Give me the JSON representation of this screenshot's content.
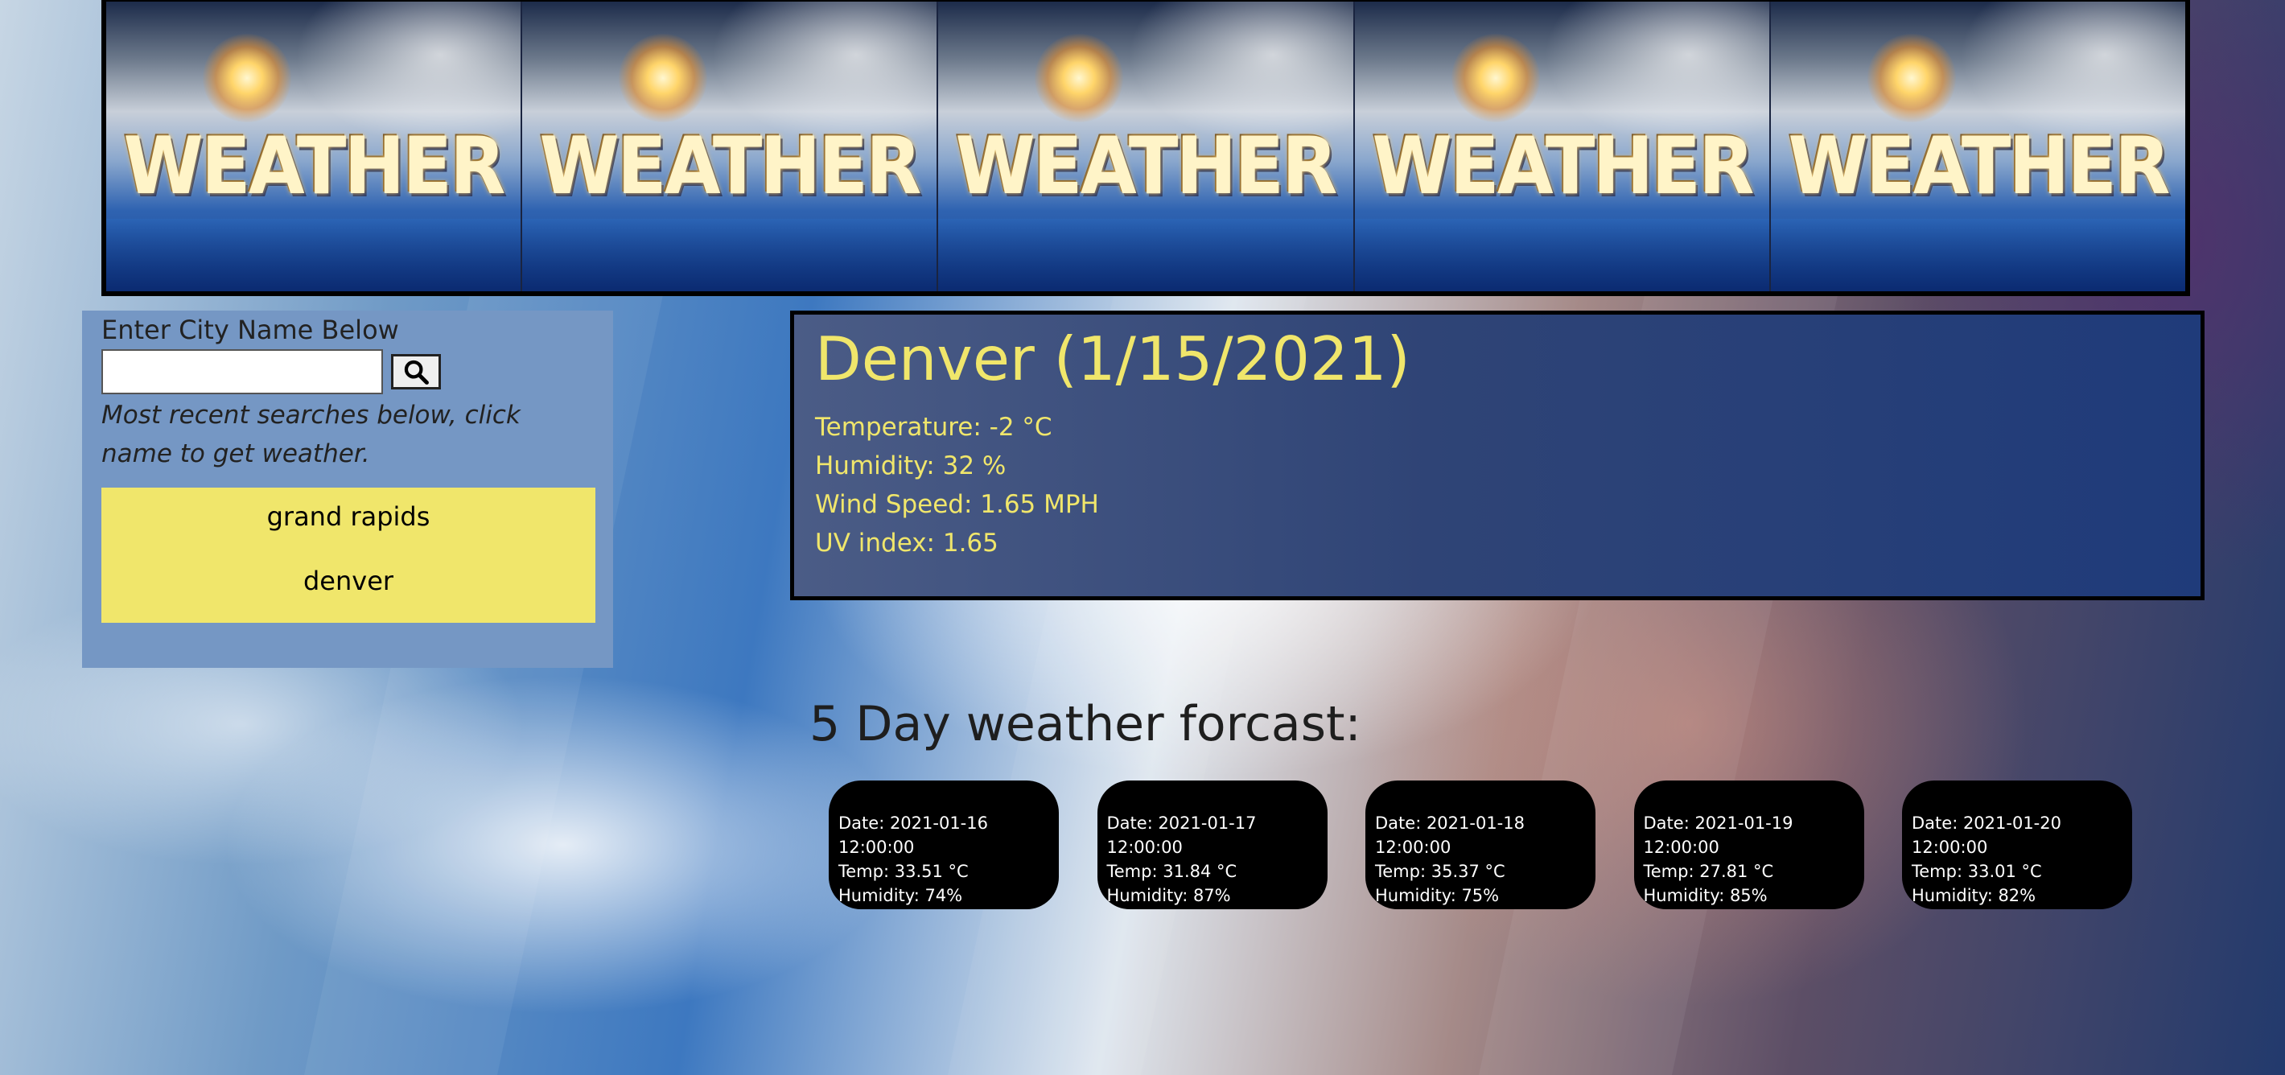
{
  "banner": {
    "word": "WEATHER",
    "tiles": 5
  },
  "search": {
    "label": "Enter City Name Below",
    "value": "",
    "placeholder": "",
    "hint": "Most recent searches below, click name to get weather.",
    "history": [
      {
        "label": "grand rapids"
      },
      {
        "label": "denver"
      }
    ]
  },
  "current": {
    "title": "Denver (1/15/2021)",
    "temperature": "Temperature: -2 °C",
    "humidity": "Humidity: 32 %",
    "wind": "Wind Speed: 1.65 MPH",
    "uv": "UV index: 1.65"
  },
  "forecast": {
    "heading": "5 Day weather forcast:",
    "days": [
      {
        "date": "Date: 2021-01-16 12:00:00",
        "temp": "Temp: 33.51 °C",
        "humidity": "Humidity: 74%"
      },
      {
        "date": "Date: 2021-01-17 12:00:00",
        "temp": "Temp: 31.84 °C",
        "humidity": "Humidity: 87%"
      },
      {
        "date": "Date: 2021-01-18 12:00:00",
        "temp": "Temp: 35.37 °C",
        "humidity": "Humidity: 75%"
      },
      {
        "date": "Date: 2021-01-19 12:00:00",
        "temp": "Temp: 27.81 °C",
        "humidity": "Humidity: 85%"
      },
      {
        "date": "Date: 2021-01-20 12:00:00",
        "temp": "Temp: 33.01 °C",
        "humidity": "Humidity: 82%"
      }
    ]
  },
  "colors": {
    "accent": "#f0e66b",
    "sidebar": "#7597c4",
    "card": "#000000"
  },
  "icons": {
    "search_button": "search-icon"
  }
}
